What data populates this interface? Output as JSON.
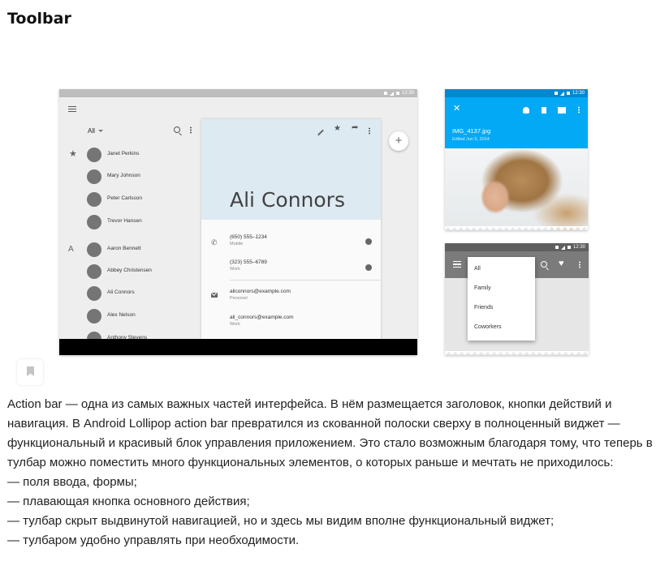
{
  "article": {
    "heading": "Toolbar",
    "paragraph": "Action bar — одна из самых важных частей интерфейса. В нём размещается заголовок, кнопки действий и навигация. В Android Lollipop action bar превратился из скованной полоски сверху в полноценный виджет — функциональный и красивый блок управления приложением. Это стало возможным благодаря тому, что теперь в тулбар можно поместить много функциональных элементов, о которых раньше и мечтать не приходилось:",
    "list": [
      "— поля ввода, формы;",
      "— плавающая кнопка основного действия;",
      "— тулбар скрыт выдвинутой навигацией, но и здесь мы видим вполне функциональный виджет;",
      "— тулбаром удобно управлять при необходимости."
    ]
  },
  "tablet": {
    "time": "12:30",
    "filter_label": "All",
    "favorites": [
      "Janet Perkins",
      "Mary Johnson",
      "Peter Carlsson",
      "Trevor Hansen"
    ],
    "group_letter": "A",
    "group_contacts": [
      "Aaron Bennett",
      "Abbey Christensen",
      "Ali Connors",
      "Alex Nelson",
      "Anthony Stevens"
    ],
    "detail": {
      "name": "Ali Connors",
      "phone1": "(650) 555–1234",
      "phone1_type": "Mobile",
      "phone2": "(323) 555–6789",
      "phone2_type": "Work",
      "email1": "aliconnors@example.com",
      "email1_type": "Personel",
      "email2": "ali_connors@example.com",
      "email2_type": "Work"
    },
    "fab_label": "+"
  },
  "photo_app": {
    "time": "12:30",
    "title": "IMG_4137.jpg",
    "subtitle": "Edited Jun 5, 2014",
    "accent": "#03a9f4"
  },
  "dropdown_app": {
    "time": "12:30",
    "options": [
      "All",
      "Family",
      "Friends",
      "Coworkers"
    ]
  },
  "icons": {
    "tablet": [
      "menu-icon",
      "search-icon",
      "more-icon",
      "edit-icon",
      "star-icon",
      "share-icon",
      "phone-icon",
      "email-icon",
      "message-icon"
    ],
    "photo": [
      "close-icon",
      "add-person-icon",
      "delete-icon",
      "move-to-folder-icon",
      "more-icon"
    ],
    "dropdown": [
      "menu-icon",
      "search-icon",
      "heart-icon",
      "more-icon"
    ],
    "article": [
      "bookmark-icon"
    ]
  }
}
